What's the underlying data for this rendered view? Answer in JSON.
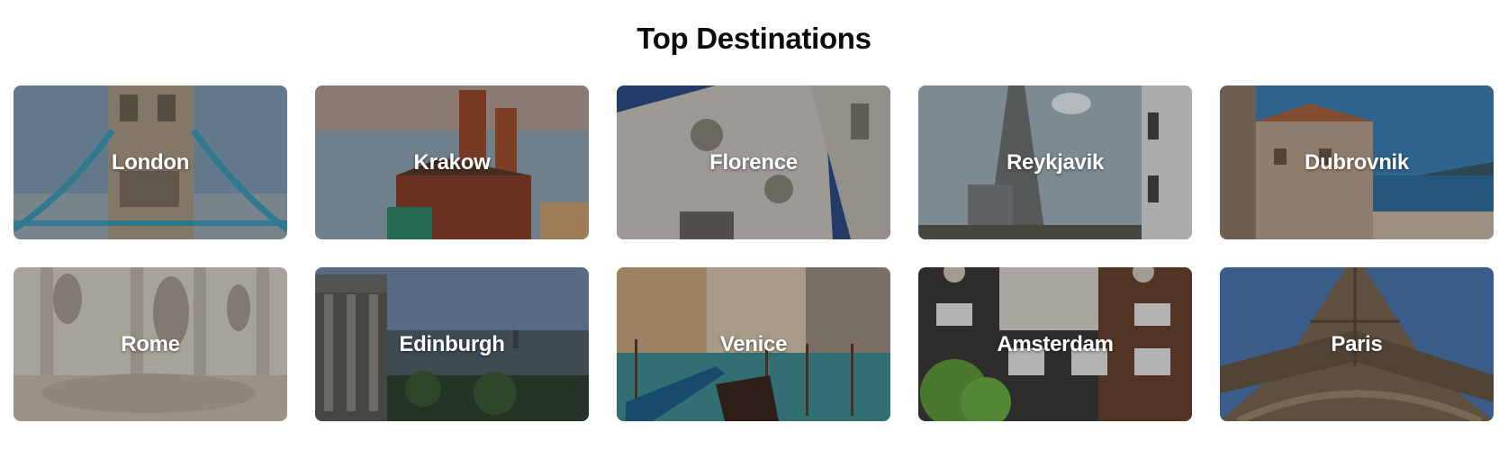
{
  "section": {
    "title": "Top Destinations"
  },
  "destinations": [
    {
      "name": "London"
    },
    {
      "name": "Krakow"
    },
    {
      "name": "Florence"
    },
    {
      "name": "Reykjavik"
    },
    {
      "name": "Dubrovnik"
    },
    {
      "name": "Rome"
    },
    {
      "name": "Edinburgh"
    },
    {
      "name": "Venice"
    },
    {
      "name": "Amsterdam"
    },
    {
      "name": "Paris"
    }
  ]
}
